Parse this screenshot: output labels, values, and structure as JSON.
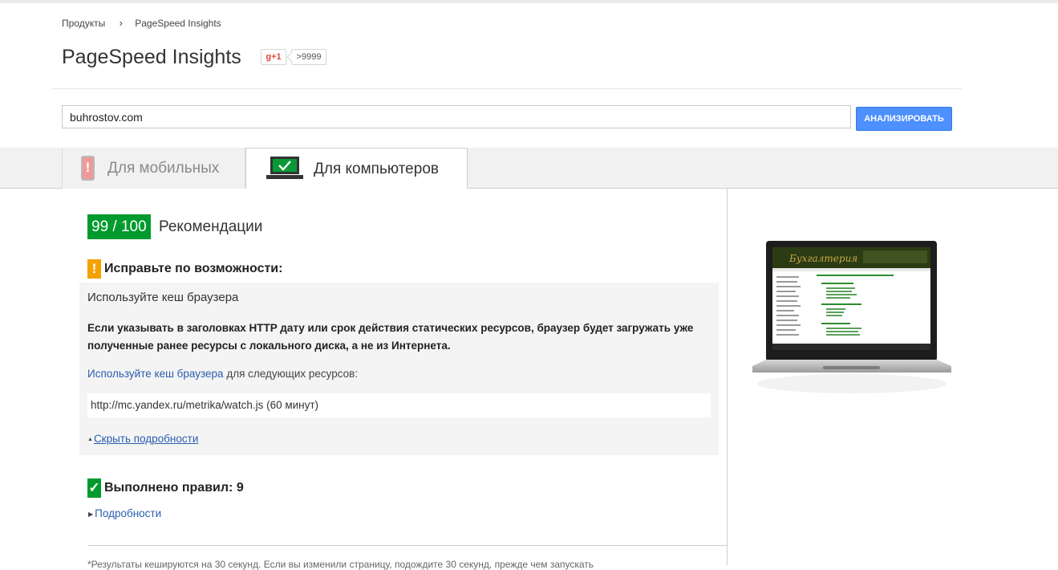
{
  "breadcrumb": {
    "parent": "Продукты",
    "current": "PageSpeed Insights"
  },
  "page_title": "PageSpeed Insights",
  "social": {
    "gplus_label": "g+1",
    "count": ">9999"
  },
  "search": {
    "value": "buhrostov.com",
    "button_label": "АНАЛИЗИРОВАТЬ"
  },
  "tabs": [
    {
      "label": "Для мобильных",
      "active": false,
      "icon": "phone-icon"
    },
    {
      "label": "Для компьютеров",
      "active": true,
      "icon": "laptop-icon"
    }
  ],
  "result": {
    "score": "99 / 100",
    "score_label": "Рекомендации",
    "warning": {
      "title": "Исправьте по возможности:",
      "rule_name": "Используйте кеш браузера",
      "description": "Если указывать в заголовках HTTP дату или срок действия статических ресурсов, браузер будет загружать уже полученные ранее ресурсы с локального диска, а не из Интернета.",
      "resources_link": "Используйте кеш браузера",
      "resources_text": " для следующих ресурсов:",
      "resource": "http://mc.yandex.ru/metrika/watch.js (60 минут)",
      "hide_link": "Скрыть подробности"
    },
    "passed": {
      "title": "Выполнено правил: 9",
      "details_link": "Подробности"
    },
    "footnote": "*Результаты кешируются на 30 секунд. Если вы изменили страницу, подождите 30 секунд, прежде чем запускать"
  },
  "colors": {
    "score_bg": "#009a2e",
    "warning": "#f4a100",
    "button": "#4d90fe",
    "link": "#2a5db0"
  }
}
